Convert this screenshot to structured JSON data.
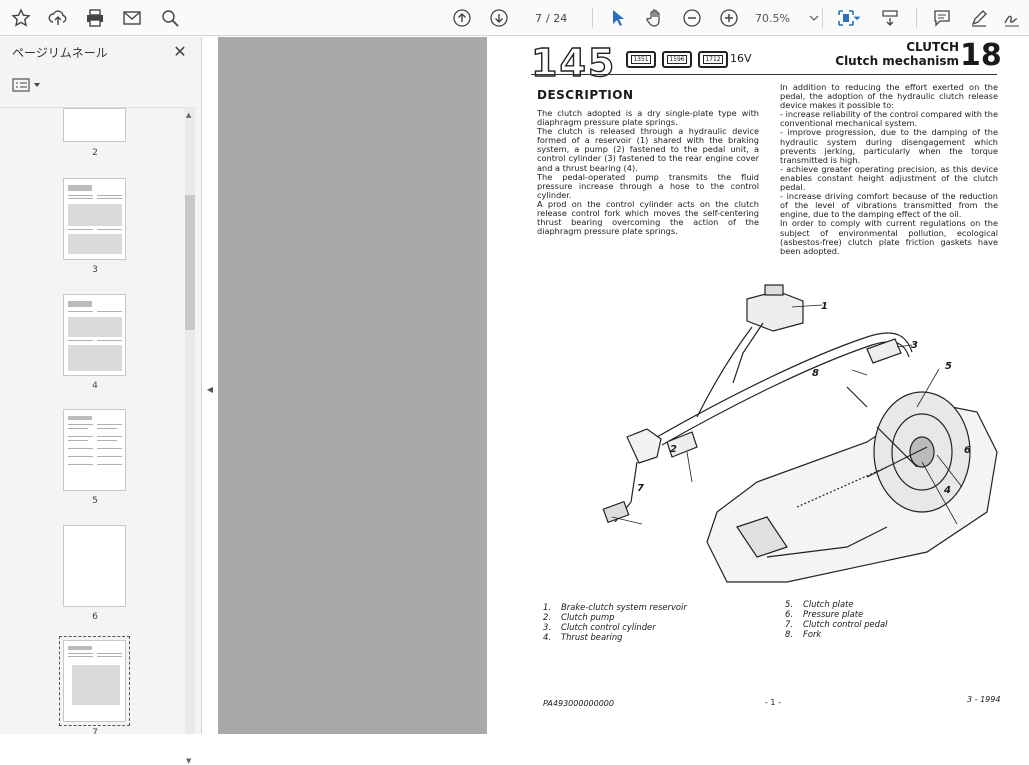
{
  "toolbar": {
    "icons": [
      "bookmark-star-icon",
      "upload-cloud-icon",
      "print-icon",
      "email-icon",
      "zoom-search-icon",
      "page-up-icon",
      "page-down-icon",
      "select-cursor-icon",
      "hand-tool-icon",
      "zoom-out-icon",
      "zoom-in-icon",
      "fit-page-icon",
      "scroll-mode-icon",
      "comment-icon",
      "pen-icon",
      "sign-icon"
    ],
    "current_page": "7",
    "total_pages": "/ 24",
    "zoom": "70.5%",
    "accent": "#2a6ebd"
  },
  "sidebar": {
    "title": "ページリムネール",
    "thumbnails": [
      {
        "label": "2"
      },
      {
        "label": "3"
      },
      {
        "label": "4"
      },
      {
        "label": "5"
      },
      {
        "label": "6"
      },
      {
        "label": "7"
      }
    ]
  },
  "page": {
    "model": "145",
    "engine_badges": [
      "1351",
      "1596",
      "1712"
    ],
    "engine_suffix": "16V",
    "section": "CLUTCH",
    "subsection": "Clutch mechanism",
    "group_number": "18",
    "heading": "DESCRIPTION",
    "left_paragraphs": [
      "The clutch adopted is a dry single-plate type with diaphragm pressure plate springs.",
      "The clutch is released through a hydraulic device formed of a reservoir (1) shared with the braking system, a pump (2) fastened to the pedal unit, a control cylinder (3) fastened to the rear engine cover and a thrust bearing (4).",
      "The pedal-operated pump transmits the fluid pressure increase through a hose to the control cylinder.",
      "A prod on the control cylinder acts on the clutch release control fork which moves the self-centering thrust bearing overcoming the action of the diaphragm pressure plate springs."
    ],
    "right_paragraphs": [
      "In addition to reducing the effort exerted on the pedal, the adoption of the hydraulic clutch release device makes it possible to:",
      "- increase reliability of the control compared with the conventional mechanical system.",
      "- improve progression, due to the damping of the hydraulic system during disengagement which prevents jerking, particularly when the torque transmitted is high.",
      "- achieve greater operating precision, as this device enables constant height adjustment of the clutch pedal.",
      "- increase driving comfort because of the reduction of the level of vibrations transmitted from the engine, due to the damping effect of the oil.",
      "In order to comply with current regulations on the subject of environmental pollution, ecological (asbestos-free) clutch plate friction gaskets have been adopted."
    ],
    "callouts": [
      "1",
      "3",
      "8",
      "5",
      "6",
      "2",
      "4",
      "7"
    ],
    "legend_left": [
      {
        "n": "1.",
        "text": "Brake-clutch system reservoir"
      },
      {
        "n": "2.",
        "text": "Clutch pump"
      },
      {
        "n": "3.",
        "text": "Clutch control cylinder"
      },
      {
        "n": "4.",
        "text": "Thrust bearing"
      }
    ],
    "legend_right": [
      {
        "n": "5.",
        "text": "Clutch plate"
      },
      {
        "n": "6.",
        "text": "Pressure plate"
      },
      {
        "n": "7.",
        "text": "Clutch control pedal"
      },
      {
        "n": "8.",
        "text": "Fork"
      }
    ],
    "footer_code": "PA493000000000",
    "footer_page": "- 1 -",
    "footer_date": "3 - 1994"
  }
}
